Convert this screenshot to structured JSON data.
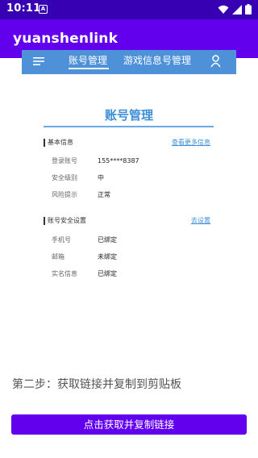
{
  "status_bar": {
    "time": "10:11",
    "notification_icon": "A",
    "icons": [
      "wifi-icon",
      "signal-icon",
      "battery-icon"
    ]
  },
  "app_bar": {
    "title": "yuanshenlink",
    "background": "#6200ee",
    "status_color": "#3700b3"
  },
  "web_nav": {
    "background": "#4f91d9",
    "tabs": [
      {
        "label": "账号管理",
        "active": true
      },
      {
        "label": "游戏信息号管理",
        "active": false
      }
    ],
    "menu_icon": "menu-icon",
    "user_icon": "user-icon"
  },
  "page": {
    "title": "账号管理",
    "accent": "#3f8fd8"
  },
  "basic_info": {
    "heading": "基本信息",
    "link": "查看更多信息",
    "rows": [
      {
        "key": "登录账号",
        "value": "155****8387"
      },
      {
        "key": "安全级别",
        "value": "中"
      },
      {
        "key": "风险提示",
        "value": "正常"
      }
    ]
  },
  "security_settings": {
    "heading": "账号安全设置",
    "link": "去设置",
    "rows": [
      {
        "key": "手机号",
        "value": "已绑定"
      },
      {
        "key": "邮箱",
        "value": "未绑定"
      },
      {
        "key": "实名信息",
        "value": "已绑定"
      }
    ]
  },
  "step": {
    "text": "第二步：获取链接并复制到剪贴板"
  },
  "action": {
    "button_label": "点击获取并复制链接"
  }
}
